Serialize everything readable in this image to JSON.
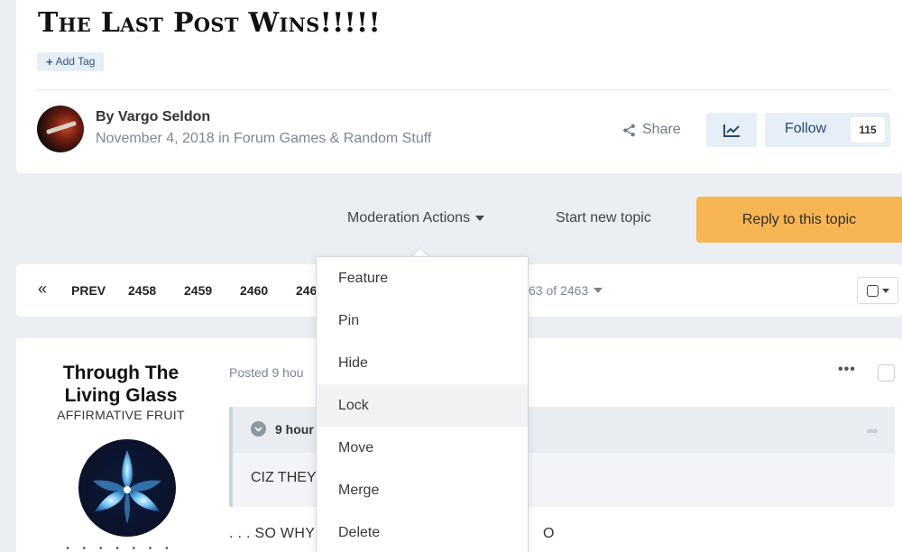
{
  "topic": {
    "title": "The Last Post Wins!!!!!",
    "add_tag_label": "Add Tag",
    "author_prefix": "By",
    "author": "Vargo Seldon",
    "meta": "November 4, 2018 in Forum Games & Random Stuff",
    "share_label": "Share",
    "follow_label": "Follow",
    "follow_count": "115"
  },
  "actions": {
    "moderation_label": "Moderation Actions",
    "start_topic_label": "Start new topic",
    "reply_label": "Reply to this topic"
  },
  "pagination": {
    "prev_label": "PREV",
    "pages": [
      "2458",
      "2459",
      "2460",
      "246"
    ],
    "page_of": "63 of 2463"
  },
  "moderation_menu": {
    "items": [
      "Feature",
      "Pin",
      "Hide",
      "Lock",
      "Move",
      "Merge",
      "Delete"
    ],
    "highlighted": "Lock"
  },
  "post": {
    "poster_name_line1": "Through The",
    "poster_name_line2": "Living Glass",
    "poster_rank": "AFFIRMATIVE FRUIT",
    "posted_meta": "Posted 9 hou",
    "quote_header": "9 hour",
    "quote_body": "CIZ THEY",
    "body_text": ". . . SO WHY",
    "body_text_tail": "O"
  },
  "colors": {
    "reply_button": "#f8b553",
    "page_bg": "#ebeef2",
    "light_button": "#e6eef7"
  },
  "icons": {
    "share": "share-icon",
    "activity": "chart-line-icon",
    "first_page": "double-chevron-left-icon",
    "quote_toggle": "chevron-down-circle-icon",
    "more": "ellipsis-icon"
  }
}
